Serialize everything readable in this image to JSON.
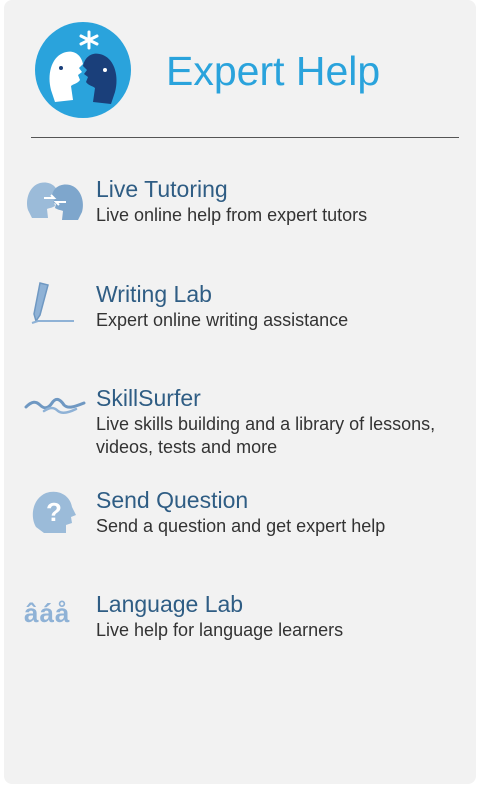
{
  "header": {
    "title": "Expert Help"
  },
  "items": [
    {
      "name": "Live Tutoring",
      "desc": "Live online help from expert tutors",
      "icon": "tutoring-heads-icon"
    },
    {
      "name": "Writing Lab",
      "desc": "Expert online writing assistance",
      "icon": "pen-icon"
    },
    {
      "name": "SkillSurfer",
      "desc": "Live skills building and a library of lessons, videos, tests and more",
      "icon": "wave-icon"
    },
    {
      "name": "Send Question",
      "desc": "Send a question and get expert help",
      "icon": "question-head-icon"
    },
    {
      "name": "Language Lab",
      "desc": "Live help for language learners",
      "icon": "accented-letters-icon",
      "icon_text": "âáå"
    }
  ],
  "colors": {
    "accent": "#2aa3dc",
    "item_title": "#2f5d84",
    "panel": "#f2f2f2"
  }
}
